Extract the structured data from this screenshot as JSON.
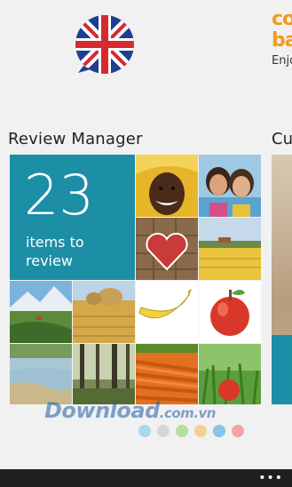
{
  "header": {
    "brand_line1": "co",
    "brand_line2": "ba",
    "brand_sub": "Enjo"
  },
  "review": {
    "title": "Review Manager",
    "count": "23",
    "caption_line1": "items to",
    "caption_line2": "review",
    "next_title": "Cu"
  },
  "watermark": {
    "main": "Download",
    "domain": ".com.vn"
  },
  "dots": [
    "#a9d8ec",
    "#d6d6d6",
    "#b6dfa2",
    "#f6cf94",
    "#89c2e8",
    "#f3a3a3"
  ],
  "appbar": {
    "more": "•••"
  },
  "colors": {
    "accent": "#1c8ea6",
    "brand": "#f29b1f"
  }
}
